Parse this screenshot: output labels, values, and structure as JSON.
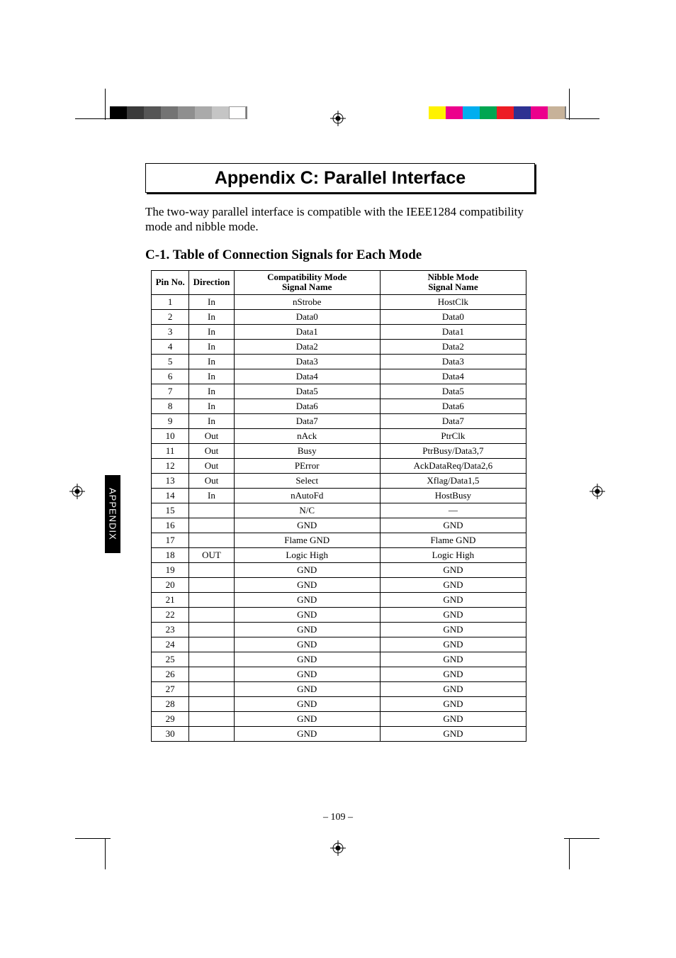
{
  "title": "Appendix C: Parallel Interface",
  "intro": "The two-way parallel interface is compatible with the IEEE1284 compatibility mode and nibble mode.",
  "section_heading": "C-1. Table of Connection Signals for Each Mode",
  "side_tab": "APPENDIX",
  "page_number": "– 109 –",
  "table": {
    "headers": {
      "pin": "Pin No.",
      "direction": "Direction",
      "compat_line1": "Compatibility Mode",
      "compat_line2": "Signal Name",
      "nibble_line1": "Nibble Mode",
      "nibble_line2": "Signal Name"
    },
    "rows": [
      {
        "pin": "1",
        "dir": "In",
        "compat": "nStrobe",
        "nibble": "HostClk"
      },
      {
        "pin": "2",
        "dir": "In",
        "compat": "Data0",
        "nibble": "Data0"
      },
      {
        "pin": "3",
        "dir": "In",
        "compat": "Data1",
        "nibble": "Data1"
      },
      {
        "pin": "4",
        "dir": "In",
        "compat": "Data2",
        "nibble": "Data2"
      },
      {
        "pin": "5",
        "dir": "In",
        "compat": "Data3",
        "nibble": "Data3"
      },
      {
        "pin": "6",
        "dir": "In",
        "compat": "Data4",
        "nibble": "Data4"
      },
      {
        "pin": "7",
        "dir": "In",
        "compat": "Data5",
        "nibble": "Data5"
      },
      {
        "pin": "8",
        "dir": "In",
        "compat": "Data6",
        "nibble": "Data6"
      },
      {
        "pin": "9",
        "dir": "In",
        "compat": "Data7",
        "nibble": "Data7"
      },
      {
        "pin": "10",
        "dir": "Out",
        "compat": "nAck",
        "nibble": "PtrClk"
      },
      {
        "pin": "11",
        "dir": "Out",
        "compat": "Busy",
        "nibble": "PtrBusy/Data3,7"
      },
      {
        "pin": "12",
        "dir": "Out",
        "compat": "PError",
        "nibble": "AckDataReq/Data2,6"
      },
      {
        "pin": "13",
        "dir": "Out",
        "compat": "Select",
        "nibble": "Xflag/Data1,5"
      },
      {
        "pin": "14",
        "dir": "In",
        "compat": "nAutoFd",
        "nibble": "HostBusy"
      },
      {
        "pin": "15",
        "dir": "",
        "compat": "N/C",
        "nibble": "—"
      },
      {
        "pin": "16",
        "dir": "",
        "compat": "GND",
        "nibble": "GND"
      },
      {
        "pin": "17",
        "dir": "",
        "compat": "Flame GND",
        "nibble": "Flame GND"
      },
      {
        "pin": "18",
        "dir": "OUT",
        "compat": "Logic High",
        "nibble": "Logic High"
      },
      {
        "pin": "19",
        "dir": "",
        "compat": "GND",
        "nibble": "GND"
      },
      {
        "pin": "20",
        "dir": "",
        "compat": "GND",
        "nibble": "GND"
      },
      {
        "pin": "21",
        "dir": "",
        "compat": "GND",
        "nibble": "GND"
      },
      {
        "pin": "22",
        "dir": "",
        "compat": "GND",
        "nibble": "GND"
      },
      {
        "pin": "23",
        "dir": "",
        "compat": "GND",
        "nibble": "GND"
      },
      {
        "pin": "24",
        "dir": "",
        "compat": "GND",
        "nibble": "GND"
      },
      {
        "pin": "25",
        "dir": "",
        "compat": "GND",
        "nibble": "GND"
      },
      {
        "pin": "26",
        "dir": "",
        "compat": "GND",
        "nibble": "GND"
      },
      {
        "pin": "27",
        "dir": "",
        "compat": "GND",
        "nibble": "GND"
      },
      {
        "pin": "28",
        "dir": "",
        "compat": "GND",
        "nibble": "GND"
      },
      {
        "pin": "29",
        "dir": "",
        "compat": "GND",
        "nibble": "GND"
      },
      {
        "pin": "30",
        "dir": "",
        "compat": "GND",
        "nibble": "GND"
      }
    ]
  },
  "chart_data": {
    "type": "table",
    "title": "Table of Connection Signals for Each Mode",
    "columns": [
      "Pin No.",
      "Direction",
      "Compatibility Mode Signal Name",
      "Nibble Mode Signal Name"
    ],
    "rows": [
      [
        "1",
        "In",
        "nStrobe",
        "HostClk"
      ],
      [
        "2",
        "In",
        "Data0",
        "Data0"
      ],
      [
        "3",
        "In",
        "Data1",
        "Data1"
      ],
      [
        "4",
        "In",
        "Data2",
        "Data2"
      ],
      [
        "5",
        "In",
        "Data3",
        "Data3"
      ],
      [
        "6",
        "In",
        "Data4",
        "Data4"
      ],
      [
        "7",
        "In",
        "Data5",
        "Data5"
      ],
      [
        "8",
        "In",
        "Data6",
        "Data6"
      ],
      [
        "9",
        "In",
        "Data7",
        "Data7"
      ],
      [
        "10",
        "Out",
        "nAck",
        "PtrClk"
      ],
      [
        "11",
        "Out",
        "Busy",
        "PtrBusy/Data3,7"
      ],
      [
        "12",
        "Out",
        "PError",
        "AckDataReq/Data2,6"
      ],
      [
        "13",
        "Out",
        "Select",
        "Xflag/Data1,5"
      ],
      [
        "14",
        "In",
        "nAutoFd",
        "HostBusy"
      ],
      [
        "15",
        "",
        "N/C",
        "—"
      ],
      [
        "16",
        "",
        "GND",
        "GND"
      ],
      [
        "17",
        "",
        "Flame GND",
        "Flame GND"
      ],
      [
        "18",
        "OUT",
        "Logic High",
        "Logic High"
      ],
      [
        "19",
        "",
        "GND",
        "GND"
      ],
      [
        "20",
        "",
        "GND",
        "GND"
      ],
      [
        "21",
        "",
        "GND",
        "GND"
      ],
      [
        "22",
        "",
        "GND",
        "GND"
      ],
      [
        "23",
        "",
        "GND",
        "GND"
      ],
      [
        "24",
        "",
        "GND",
        "GND"
      ],
      [
        "25",
        "",
        "GND",
        "GND"
      ],
      [
        "26",
        "",
        "GND",
        "GND"
      ],
      [
        "27",
        "",
        "GND",
        "GND"
      ],
      [
        "28",
        "",
        "GND",
        "GND"
      ],
      [
        "29",
        "",
        "GND",
        "GND"
      ],
      [
        "30",
        "",
        "GND",
        "GND"
      ]
    ]
  },
  "colorbar_left": [
    "#000000",
    "#3a3a3a",
    "#565656",
    "#747474",
    "#8f8f8f",
    "#aaaaaa",
    "#c5c5c5",
    "#ffffff"
  ],
  "colorbar_right": [
    "#fff200",
    "#ec008c",
    "#00aeef",
    "#00a651",
    "#ed1c24",
    "#2e3192",
    "#ec008c",
    "#c7b299"
  ]
}
